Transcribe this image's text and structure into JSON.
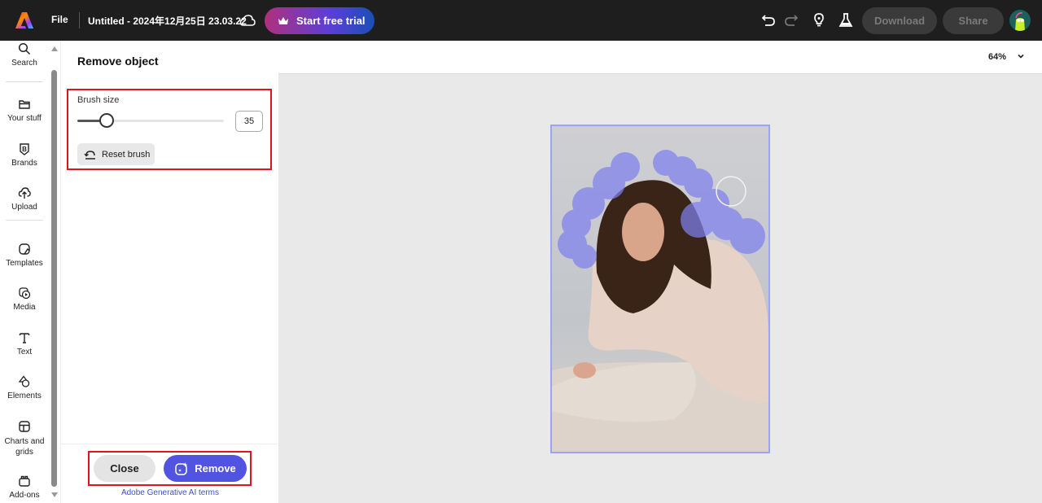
{
  "topbar": {
    "file_label": "File",
    "doc_title": "Untitled - 2024年12月25日 23.03.22",
    "trial_label": "Start free trial",
    "download_label": "Download",
    "share_label": "Share",
    "icons": [
      "adobe-express-logo",
      "cloud-icon",
      "crown-icon",
      "undo-icon",
      "redo-icon",
      "lightbulb-icon",
      "flask-icon",
      "avatar"
    ]
  },
  "rail": {
    "items": [
      {
        "label": "Search",
        "icon": "search-icon"
      },
      {
        "label": "Your stuff",
        "icon": "folder-icon"
      },
      {
        "label": "Brands",
        "icon": "brand-icon"
      },
      {
        "label": "Upload",
        "icon": "upload-icon"
      },
      {
        "label": "Templates",
        "icon": "templates-icon"
      },
      {
        "label": "Media",
        "icon": "media-icon"
      },
      {
        "label": "Text",
        "icon": "text-icon"
      },
      {
        "label": "Elements",
        "icon": "elements-icon"
      },
      {
        "label": "Charts and grids",
        "icon": "charts-grid-icon"
      },
      {
        "label": "Add-ons",
        "icon": "addons-icon"
      }
    ]
  },
  "panel": {
    "title": "Remove object",
    "brush_label": "Brush size",
    "brush_value": "35",
    "brush_fraction": 0.2,
    "reset_label": "Reset brush",
    "close_label": "Close",
    "remove_label": "Remove",
    "ai_terms_label": "Adobe Generative AI terms"
  },
  "canvas": {
    "zoom": "64%",
    "accent_color": "#5154e0",
    "highlight_color": "#e0141e"
  }
}
